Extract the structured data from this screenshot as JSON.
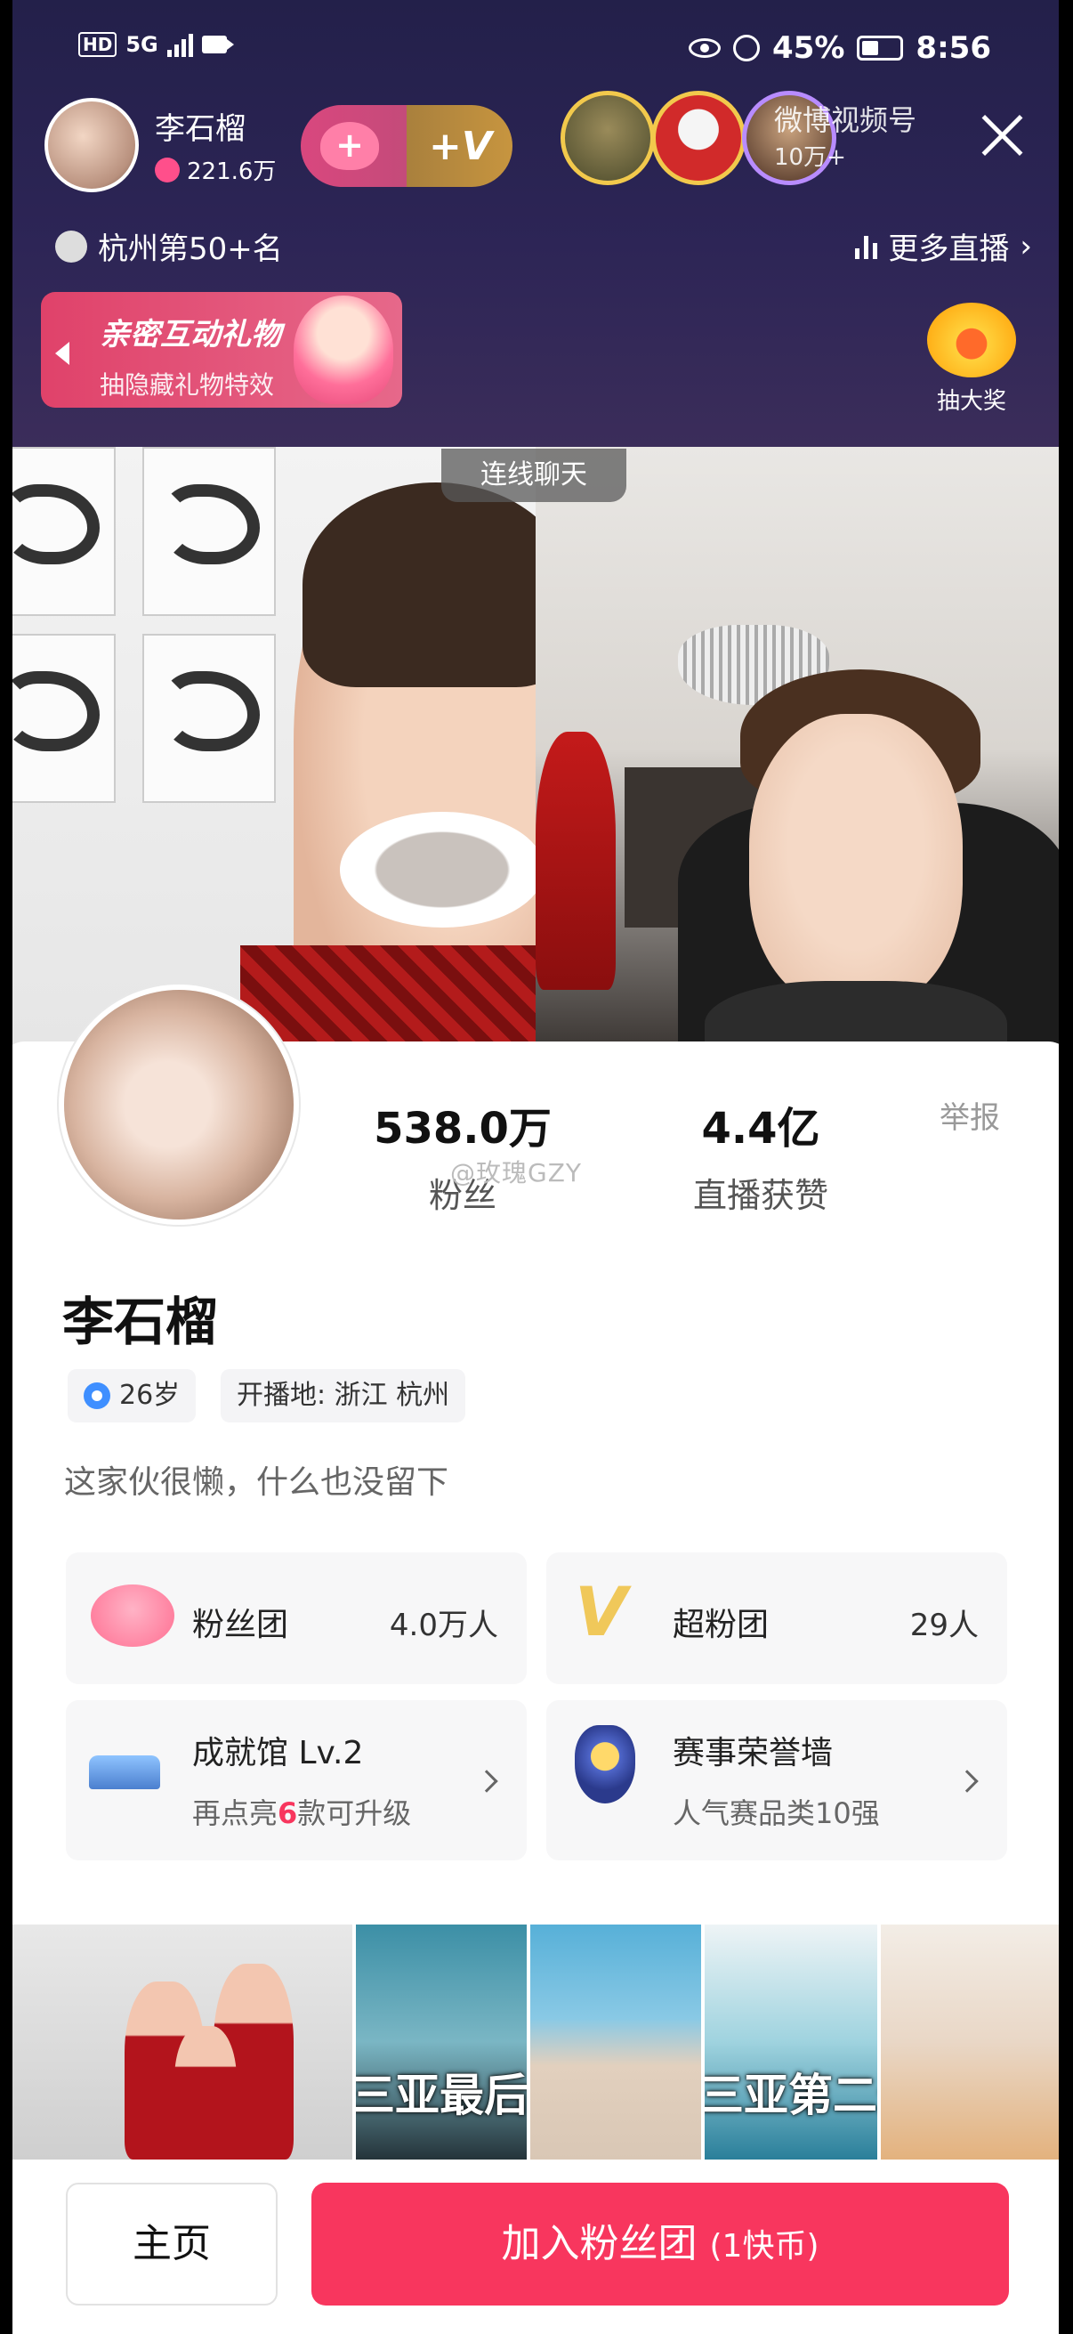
{
  "status_bar": {
    "hd": "HD",
    "network": "5G",
    "battery_percent": "45%",
    "battery_level": 0.45,
    "time": "8:56"
  },
  "host": {
    "name": "李石榴",
    "hearts": "221.6万"
  },
  "join_button": {
    "plus_icon": "+",
    "v_label": "+V"
  },
  "viewers_count": "10万+",
  "weibo_watermark": "微博视频号",
  "rank_text": "杭州第50+名",
  "more_live": "更多直播",
  "gift_banner": {
    "title": "亲密互动礼物",
    "subtitle": "抽隐藏礼物特效"
  },
  "lottery_label": "抽大奖",
  "call_tag": "连线聊天",
  "profile": {
    "fans_count": "538.0万",
    "fans_label": "粉丝",
    "likes_count": "4.4亿",
    "likes_label": "直播获赞",
    "report": "举报",
    "weibo_tag": "@玫瑰GZY",
    "name": "李石榴",
    "age": "26岁",
    "location": "开播地: 浙江 杭州",
    "bio": "这家伙很懒，什么也没留下"
  },
  "tiles": {
    "fan_group_label": "粉丝团",
    "fan_group_count": "4.0万人",
    "super_fan_label": "超粉团",
    "super_fan_count": "29人",
    "achievement_title": "成就馆 Lv.2",
    "achievement_sub_pre": "再点亮",
    "achievement_sub_num": "6",
    "achievement_sub_post": "款可升级",
    "honor_title": "赛事荣誉墙",
    "honor_sub": "人气赛品类10强"
  },
  "videos": [
    {
      "caption": ""
    },
    {
      "caption": "三亚最后一天vlo"
    },
    {
      "caption": "三亚第二天vlog"
    }
  ],
  "bottom": {
    "home_label": "主页",
    "join_label": "加入粉丝团",
    "join_price": "(1快币)"
  },
  "colors": {
    "accent": "#f8365e",
    "top_bg": "#2d2556",
    "gift_pink": "#e0426a"
  }
}
